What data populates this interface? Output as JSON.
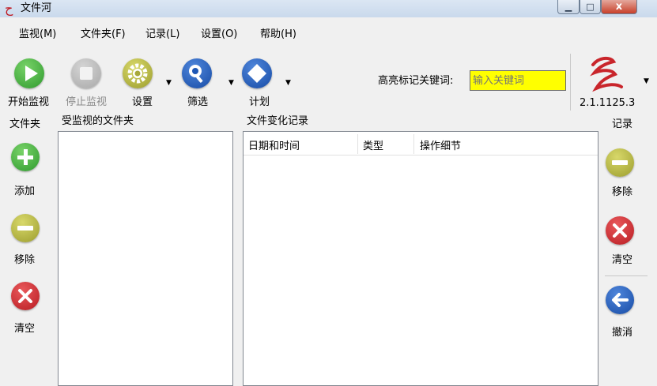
{
  "window": {
    "title": "文件河"
  },
  "menu": [
    "监视(M)",
    "文件夹(F)",
    "记录(L)",
    "设置(O)",
    "帮助(H)"
  ],
  "toolbar": {
    "start_label": "开始监视",
    "stop_label": "停止监视",
    "settings_label": "设置",
    "filter_label": "筛选",
    "schedule_label": "计划",
    "highlight_label": "高亮标记关键词:",
    "keyword_placeholder": "输入关键词",
    "version": "2.1.1125.3"
  },
  "left_sidebar": {
    "title": "文件夹",
    "add_label": "添加",
    "remove_label": "移除",
    "clear_label": "清空"
  },
  "folders_panel": {
    "title": "受监视的文件夹"
  },
  "log_panel": {
    "title": "文件变化记录",
    "columns": [
      "日期和时间",
      "类型",
      "操作细节"
    ]
  },
  "right_sidebar": {
    "title": "记录",
    "remove_label": "移除",
    "clear_label": "清空",
    "undo_label": "撤消"
  },
  "colors": {
    "green": "#3aa539",
    "gray_disabled": "#b4b4b4",
    "olive": "#a7a83a",
    "blue": "#1e57b5",
    "red": "#c9252b",
    "keyword_bg": "#ffff00"
  }
}
